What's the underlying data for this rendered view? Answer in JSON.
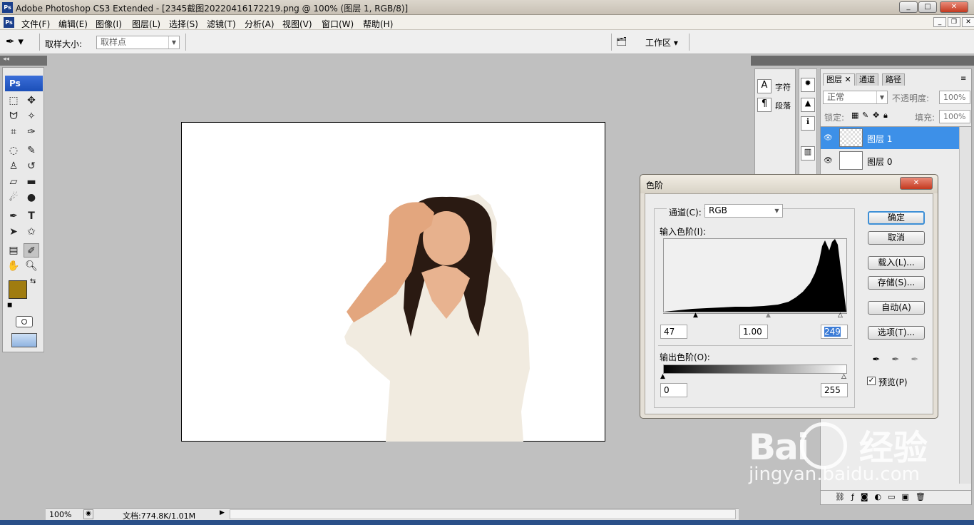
{
  "window": {
    "title": "Adobe Photoshop CS3 Extended - [2345截图20220416172219.png @ 100% (图层 1, RGB/8)]",
    "app_icon": "Ps"
  },
  "menu": [
    "文件(F)",
    "编辑(E)",
    "图像(I)",
    "图层(L)",
    "选择(S)",
    "滤镜(T)",
    "分析(A)",
    "视图(V)",
    "窗口(W)",
    "帮助(H)"
  ],
  "options": {
    "sample_label": "取样大小:",
    "sample_value": "取样点",
    "workspace": "工作区"
  },
  "toolbox": {
    "header": "Ps",
    "fg_color": "#a07c10",
    "bg_color": "#ffffff"
  },
  "status": {
    "zoom": "100%",
    "doc_info": "文档:774.8K/1.01M"
  },
  "char_panel": {
    "char": "字符",
    "para": "段落"
  },
  "layers_panel": {
    "tabs": [
      "图层",
      "通道",
      "路径"
    ],
    "blend_mode": "正常",
    "opacity_label": "不透明度:",
    "opacity": "100%",
    "lock_label": "锁定:",
    "fill_label": "填充:",
    "fill": "100%",
    "layers": [
      {
        "name": "图层 1",
        "selected": true
      },
      {
        "name": "图层 0",
        "selected": false
      }
    ]
  },
  "levels_dialog": {
    "title": "色阶",
    "channel_label": "通道(C):",
    "channel": "RGB",
    "input_label": "输入色阶(I):",
    "input_black": "47",
    "input_gamma": "1.00",
    "input_white": "249",
    "output_label": "输出色阶(O):",
    "output_black": "0",
    "output_white": "255",
    "buttons": {
      "ok": "确定",
      "cancel": "取消",
      "load": "载入(L)...",
      "save": "存储(S)...",
      "auto": "自动(A)",
      "options": "选项(T)..."
    },
    "preview_label": "预览(P)",
    "preview_checked": true
  },
  "watermark": {
    "brand": "Bai",
    "brand2": "经验",
    "url": "jingyan.baidu.com"
  }
}
